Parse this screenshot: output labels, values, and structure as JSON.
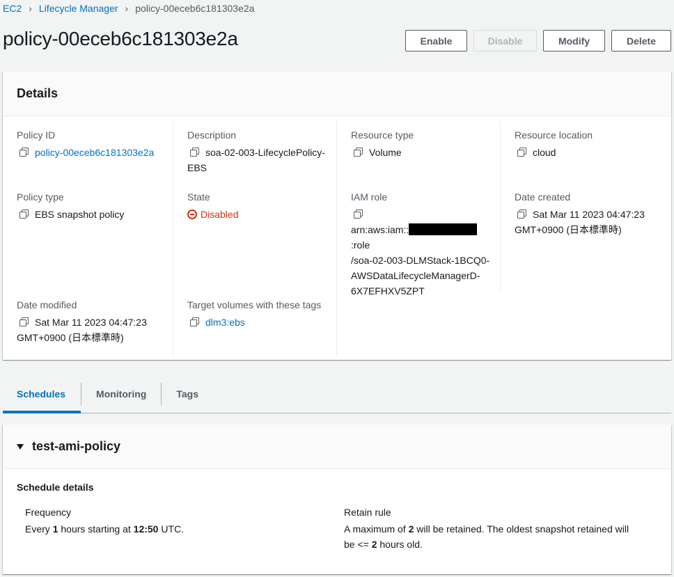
{
  "breadcrumb": {
    "items": [
      "EC2",
      "Lifecycle Manager"
    ],
    "current": "policy-00eceb6c181303e2a"
  },
  "page": {
    "title": "policy-00eceb6c181303e2a"
  },
  "actions": {
    "enable": "Enable",
    "disable": "Disable",
    "modify": "Modify",
    "delete": "Delete"
  },
  "details": {
    "header": "Details",
    "policy_id": {
      "label": "Policy ID",
      "value": "policy-00eceb6c181303e2a"
    },
    "description": {
      "label": "Description",
      "value_line1": "soa-02-003-LifecyclePolicy-",
      "value_line2": "EBS"
    },
    "resource_type": {
      "label": "Resource type",
      "value": "Volume"
    },
    "resource_location": {
      "label": "Resource location",
      "value": "cloud"
    },
    "policy_type": {
      "label": "Policy type",
      "value": "EBS snapshot policy"
    },
    "state": {
      "label": "State",
      "value": "Disabled"
    },
    "iam_role": {
      "label": "IAM role",
      "prefix": "arn:aws:iam::",
      "suffix": ":role",
      "line2": "/soa-02-003-DLMStack-1BCQ0-",
      "line3": "AWSDataLifecycleManagerD-",
      "line4": "6X7EFHXV5ZPT"
    },
    "date_created": {
      "label": "Date created",
      "line1": "Sat Mar 11 2023 04:47:23",
      "line2": "GMT+0900 (日本標準時)"
    },
    "date_modified": {
      "label": "Date modified",
      "line1": "Sat Mar 11 2023 04:47:23",
      "line2": "GMT+0900 (日本標準時)"
    },
    "target_tags": {
      "label": "Target volumes with these tags",
      "value": "dlm3:ebs"
    }
  },
  "tabs": [
    {
      "label": "Schedules",
      "active": true
    },
    {
      "label": "Monitoring",
      "active": false
    },
    {
      "label": "Tags",
      "active": false
    }
  ],
  "schedule": {
    "name": "test-ami-policy",
    "section_title": "Schedule details",
    "frequency": {
      "label": "Frequency",
      "pre": "Every ",
      "count": "1",
      "mid": " hours starting at ",
      "time": "12:50",
      "post": " UTC."
    },
    "retain": {
      "label": "Retain rule",
      "pre": "A maximum of ",
      "count": "2",
      "mid": " will be retained. The oldest snapshot retained will",
      "line2_pre": "be <= ",
      "line2_count": "2",
      "line2_post": " hours old."
    }
  },
  "colors": {
    "link": "#0073bb",
    "danger": "#d13212",
    "background": "#f2f3f3"
  }
}
